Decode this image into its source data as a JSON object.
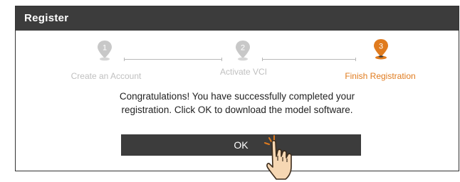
{
  "dialog": {
    "title": "Register"
  },
  "steps": [
    {
      "number": "1",
      "label": "Create an Account",
      "state": "done"
    },
    {
      "number": "2",
      "label": "Activate VCI",
      "state": "done"
    },
    {
      "number": "3",
      "label": "Finish Registration",
      "state": "active"
    }
  ],
  "colors": {
    "active": "#e07b1e",
    "inactive": "#c8c8c8",
    "dark": "#3c3c3c"
  },
  "message": {
    "line1": "Congratulations! You have successfully completed your",
    "line2": "registration. Click OK to download the model software."
  },
  "ok_button": {
    "label": "OK"
  },
  "icons": {
    "step_marker": "map-pin-icon",
    "pointer": "pointing-hand-icon"
  }
}
